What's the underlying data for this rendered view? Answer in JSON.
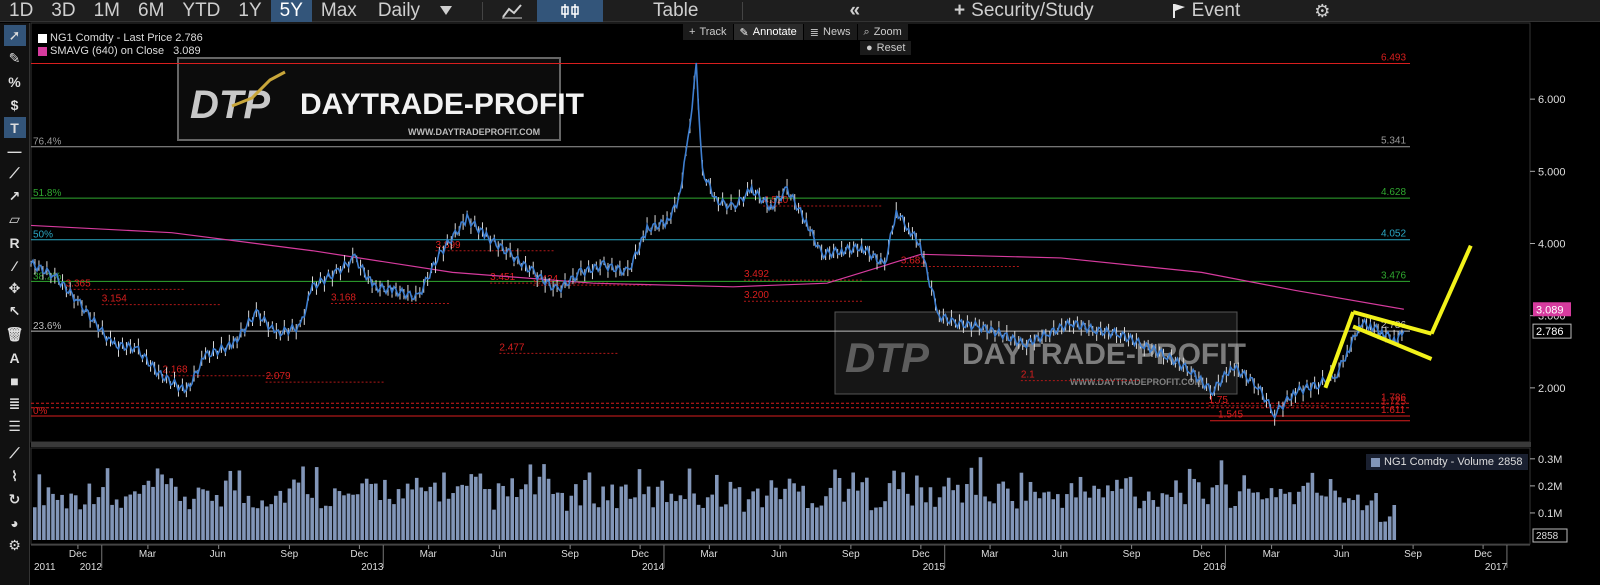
{
  "toolbar": {
    "ranges": [
      "1D",
      "3D",
      "1M",
      "6M",
      "YTD",
      "1Y",
      "5Y",
      "Max"
    ],
    "active_range": "5Y",
    "frequency": "Daily",
    "table_label": "Table",
    "security_label": "Security/Study",
    "event_label": "Event"
  },
  "annotate_bar": {
    "track": "Track",
    "annotate": "Annotate",
    "news": "News",
    "zoom": "Zoom",
    "reset": "Reset"
  },
  "legend": {
    "price_label": "NG1 Comdty - Last Price",
    "price_value": "2.786",
    "sma_label": "SMAVG (640) on Close",
    "sma_value": "3.089",
    "volume_label": "NG1 Comdty - Volume",
    "volume_value": "2858"
  },
  "watermark": {
    "brand": "DAYTRADE-PROFIT",
    "mono": "DTP",
    "url": "WWW.DAYTRADEPROFIT.COM",
    "small_url": "WWW.DAYTRADE-PROFIT.COM"
  },
  "colors": {
    "price": "#3f7fd0",
    "sma": "#d63b9e",
    "pattern": "#f2f21a",
    "red_level": "#d81e1e",
    "volume": "#8296b8"
  },
  "chart_data": {
    "type": "line",
    "instrument": "NG1 Comdty",
    "x_axis": {
      "range": [
        "2011-10-01",
        "2017-01-31"
      ],
      "months": [
        "Dec",
        "Mar",
        "Jun",
        "Sep",
        "Dec",
        "Mar",
        "Jun",
        "Sep",
        "Dec",
        "Mar",
        "Jun",
        "Sep",
        "Dec",
        "Mar",
        "Jun",
        "Sep",
        "Dec",
        "Mar",
        "Jun",
        "Sep",
        "Dec"
      ],
      "month_dates": [
        "2011-12-01",
        "2012-03-01",
        "2012-06-01",
        "2012-09-01",
        "2012-12-01",
        "2013-03-01",
        "2013-06-01",
        "2013-09-01",
        "2013-12-01",
        "2014-03-01",
        "2014-06-01",
        "2014-09-01",
        "2014-12-01",
        "2015-03-01",
        "2015-06-01",
        "2015-09-01",
        "2015-12-01",
        "2016-03-01",
        "2016-06-01",
        "2016-09-01",
        "2016-12-01"
      ],
      "years": [
        "2011",
        "2012",
        "2013",
        "2014",
        "2015",
        "2016",
        "2017"
      ],
      "year_dates": [
        "2011-10-01",
        "2012-01-01",
        "2013-01-01",
        "2014-01-01",
        "2015-01-01",
        "2016-01-01",
        "2017-01-01"
      ]
    },
    "price_axis": {
      "ticks": [
        "2.000",
        "3.000",
        "4.000",
        "5.000",
        "6.000"
      ],
      "tick_values": [
        2,
        3,
        4,
        5,
        6
      ],
      "ylim": [
        1.25,
        6.75
      ]
    },
    "volume_axis": {
      "ticks": [
        "0.1M",
        "0.2M",
        "0.3M"
      ],
      "tick_values": [
        100000,
        200000,
        300000
      ],
      "ylim": [
        0,
        340000
      ]
    },
    "last_price": "2.786",
    "last_sma": "3.089",
    "last_volume": "2858",
    "price_series": [
      [
        "2011-10-01",
        3.72
      ],
      [
        "2011-11-01",
        3.55
      ],
      [
        "2011-12-01",
        3.2
      ],
      [
        "2012-01-15",
        2.6
      ],
      [
        "2012-02-15",
        2.55
      ],
      [
        "2012-03-15",
        2.2
      ],
      [
        "2012-04-20",
        1.95
      ],
      [
        "2012-05-15",
        2.45
      ],
      [
        "2012-06-20",
        2.6
      ],
      [
        "2012-07-20",
        3.05
      ],
      [
        "2012-08-15",
        2.75
      ],
      [
        "2012-09-15",
        2.85
      ],
      [
        "2012-10-01",
        3.4
      ],
      [
        "2012-11-01",
        3.6
      ],
      [
        "2012-11-25",
        3.8
      ],
      [
        "2012-12-20",
        3.4
      ],
      [
        "2013-01-15",
        3.35
      ],
      [
        "2013-02-15",
        3.25
      ],
      [
        "2013-03-15",
        3.85
      ],
      [
        "2013-04-20",
        4.35
      ],
      [
        "2013-05-15",
        4.1
      ],
      [
        "2013-06-15",
        3.85
      ],
      [
        "2013-07-15",
        3.6
      ],
      [
        "2013-08-15",
        3.35
      ],
      [
        "2013-09-15",
        3.6
      ],
      [
        "2013-10-15",
        3.7
      ],
      [
        "2013-11-15",
        3.6
      ],
      [
        "2013-12-10",
        4.2
      ],
      [
        "2014-01-05",
        4.3
      ],
      [
        "2014-01-20",
        4.6
      ],
      [
        "2014-02-01",
        5.4
      ],
      [
        "2014-02-12",
        6.45
      ],
      [
        "2014-02-20",
        5.0
      ],
      [
        "2014-03-10",
        4.6
      ],
      [
        "2014-04-01",
        4.5
      ],
      [
        "2014-04-25",
        4.75
      ],
      [
        "2014-05-20",
        4.5
      ],
      [
        "2014-06-10",
        4.75
      ],
      [
        "2014-07-05",
        4.3
      ],
      [
        "2014-07-25",
        3.85
      ],
      [
        "2014-08-20",
        3.9
      ],
      [
        "2014-09-15",
        3.95
      ],
      [
        "2014-10-15",
        3.7
      ],
      [
        "2014-10-30",
        4.45
      ],
      [
        "2014-11-15",
        4.2
      ],
      [
        "2014-11-30",
        4.0
      ],
      [
        "2014-12-10",
        3.55
      ],
      [
        "2014-12-25",
        3.0
      ],
      [
        "2015-01-15",
        2.9
      ],
      [
        "2015-02-15",
        2.85
      ],
      [
        "2015-03-15",
        2.75
      ],
      [
        "2015-04-15",
        2.6
      ],
      [
        "2015-05-15",
        2.75
      ],
      [
        "2015-06-15",
        2.9
      ],
      [
        "2015-07-15",
        2.8
      ],
      [
        "2015-08-15",
        2.75
      ],
      [
        "2015-09-15",
        2.6
      ],
      [
        "2015-10-15",
        2.45
      ],
      [
        "2015-11-15",
        2.25
      ],
      [
        "2015-12-15",
        1.95
      ],
      [
        "2016-01-10",
        2.3
      ],
      [
        "2016-02-10",
        2.05
      ],
      [
        "2016-03-05",
        1.64
      ],
      [
        "2016-04-01",
        1.95
      ],
      [
        "2016-05-01",
        2.05
      ],
      [
        "2016-05-25",
        2.2
      ],
      [
        "2016-06-10",
        2.55
      ],
      [
        "2016-06-25",
        2.9
      ],
      [
        "2016-07-10",
        2.85
      ],
      [
        "2016-07-25",
        2.75
      ],
      [
        "2016-08-10",
        2.65
      ],
      [
        "2016-08-20",
        2.79
      ]
    ],
    "sma_series": [
      [
        "2011-10-01",
        4.25
      ],
      [
        "2012-04-01",
        4.15
      ],
      [
        "2012-10-01",
        3.9
      ],
      [
        "2013-04-01",
        3.6
      ],
      [
        "2013-10-01",
        3.45
      ],
      [
        "2014-04-01",
        3.4
      ],
      [
        "2014-08-01",
        3.45
      ],
      [
        "2014-12-01",
        3.85
      ],
      [
        "2015-06-01",
        3.8
      ],
      [
        "2015-12-01",
        3.6
      ],
      [
        "2016-04-01",
        3.35
      ],
      [
        "2016-08-20",
        3.089
      ]
    ],
    "fib_levels": [
      {
        "pct": "76.4%",
        "value": "5.341",
        "color": "#9a9a9a"
      },
      {
        "pct": "51.8%",
        "value": "4.628",
        "color": "#2fa82f"
      },
      {
        "pct": "50%",
        "value": "4.052",
        "color": "#2aa7c4"
      },
      {
        "pct": "38.2%",
        "value": "3.476",
        "color": "#2fa82f"
      },
      {
        "pct": "23.6%",
        "value": "2.786",
        "color": "#bdbdbd"
      },
      {
        "pct": "0%",
        "value": "1.611",
        "color": "#d81e1e"
      }
    ],
    "red_levels": [
      {
        "label": "6.493",
        "value": 6.493,
        "side": "right"
      },
      {
        "label": "1.786",
        "value": 1.786,
        "side": "right"
      },
      {
        "label": "1.725",
        "value": 1.725,
        "side": "right"
      },
      {
        "label": "1.545",
        "value": 1.545,
        "side": "mid"
      }
    ],
    "annotations": [
      {
        "label": "3.365",
        "value": 3.365,
        "date": "2011-11-15"
      },
      {
        "label": "3.154",
        "value": 3.154,
        "date": "2012-01-01"
      },
      {
        "label": "2.168",
        "value": 2.168,
        "date": "2012-03-20"
      },
      {
        "label": "2.079",
        "value": 2.079,
        "date": "2012-08-01"
      },
      {
        "label": "3.168",
        "value": 3.168,
        "date": "2012-10-25"
      },
      {
        "label": "2.477",
        "value": 2.477,
        "date": "2013-06-01"
      },
      {
        "label": "3.899",
        "value": 3.899,
        "date": "2013-03-10"
      },
      {
        "label": "3.451",
        "value": 3.451,
        "date": "2013-05-20"
      },
      {
        "label": "3.424",
        "value": 3.424,
        "date": "2013-07-15"
      },
      {
        "label": "3.492",
        "value": 3.492,
        "date": "2014-04-15"
      },
      {
        "label": "3.200",
        "value": 3.2,
        "date": "2014-04-15"
      },
      {
        "label": "3.681",
        "value": 3.681,
        "date": "2014-11-05"
      },
      {
        "label": "4.520",
        "value": 4.52,
        "date": "2014-05-10"
      },
      {
        "label": "1.75",
        "value": 1.75,
        "date": "2015-12-10"
      },
      {
        "label": "2.1",
        "value": 2.1,
        "date": "2015-04-10"
      }
    ],
    "volume_series": [
      0.22,
      0.18,
      0.2,
      0.24,
      0.16,
      0.19,
      0.23,
      0.2,
      0.17,
      0.21,
      0.25,
      0.19,
      0.2,
      0.22,
      0.26,
      0.21,
      0.18,
      0.2,
      0.23,
      0.19,
      0.21,
      0.24,
      0.2,
      0.22,
      0.19,
      0.21,
      0.25,
      0.2,
      0.18,
      0.22,
      0.2,
      0.23,
      0.19,
      0.21,
      0.24,
      0.2,
      0.22,
      0.18,
      0.2,
      0.23,
      0.21,
      0.19,
      0.25,
      0.22,
      0.2,
      0.24,
      0.21,
      0.19,
      0.22,
      0.27,
      0.2,
      0.21,
      0.23,
      0.18,
      0.2,
      0.22,
      0.2,
      0.24,
      0.19,
      0.21,
      0.23,
      0.2,
      0.26,
      0.21,
      0.19,
      0.22,
      0.2,
      0.23,
      0.21,
      0.2,
      0.18,
      0.12
    ],
    "pattern": {
      "name": "bull flag",
      "points": [
        {
          "date": "2016-05-10",
          "value": 2.0
        },
        {
          "date": "2016-06-15",
          "value": 3.05
        },
        {
          "date": "2016-09-25",
          "value": 2.75
        },
        {
          "date": "2016-06-15",
          "value": 2.85
        },
        {
          "date": "2016-09-25",
          "value": 2.4
        },
        {
          "date": "2016-09-25",
          "value": 2.75
        },
        {
          "date": "2016-11-15",
          "value": 3.97
        }
      ]
    }
  }
}
